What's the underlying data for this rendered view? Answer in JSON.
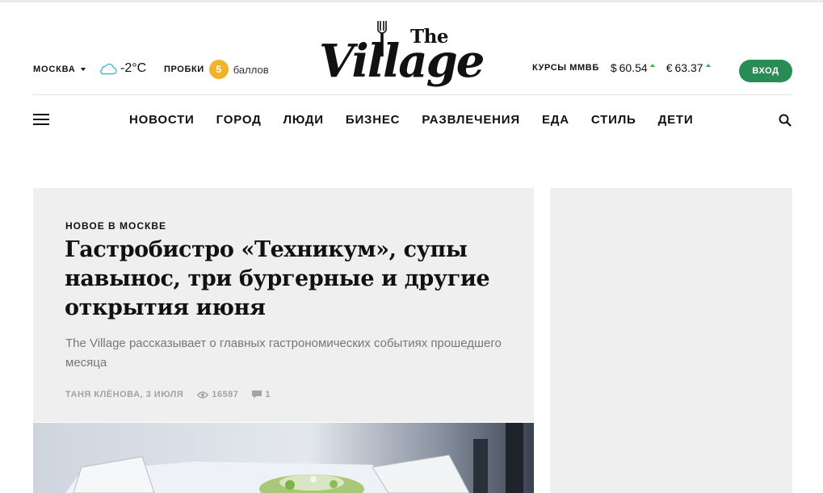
{
  "header": {
    "city": "МОСКВА",
    "weather": {
      "icon": "cloud-icon",
      "temperature": "-2°C"
    },
    "traffic": {
      "label": "ПРОБКИ",
      "score": "5",
      "unit": "баллов",
      "badge_color": "#f0b32a"
    },
    "logo": {
      "the": "The",
      "village": "Village"
    },
    "rates": {
      "label": "КУРСЫ ММВБ",
      "items": [
        {
          "symbol": "$",
          "value": "60.54",
          "trend": "up"
        },
        {
          "symbol": "€",
          "value": "63.37",
          "trend": "up"
        }
      ]
    },
    "login_label": "ВХОД",
    "login_color": "#2a8c55"
  },
  "nav": {
    "items": [
      "НОВОСТИ",
      "ГОРОД",
      "ЛЮДИ",
      "БИЗНЕС",
      "РАЗВЛЕЧЕНИЯ",
      "ЕДА",
      "СТИЛЬ",
      "ДЕТИ"
    ]
  },
  "featured": {
    "rubric": "НОВОЕ В МОСКВЕ",
    "title": "Гастробистро «Техникум», супы навынос, три бургерные и другие открытия июня",
    "lead": "The Village рассказывает о главных гастрономических событиях прошедшего месяца",
    "author_date": "ТАНЯ КЛЁНОВА, 3 ИЮЛЯ",
    "views": "16587",
    "comments": "1"
  }
}
